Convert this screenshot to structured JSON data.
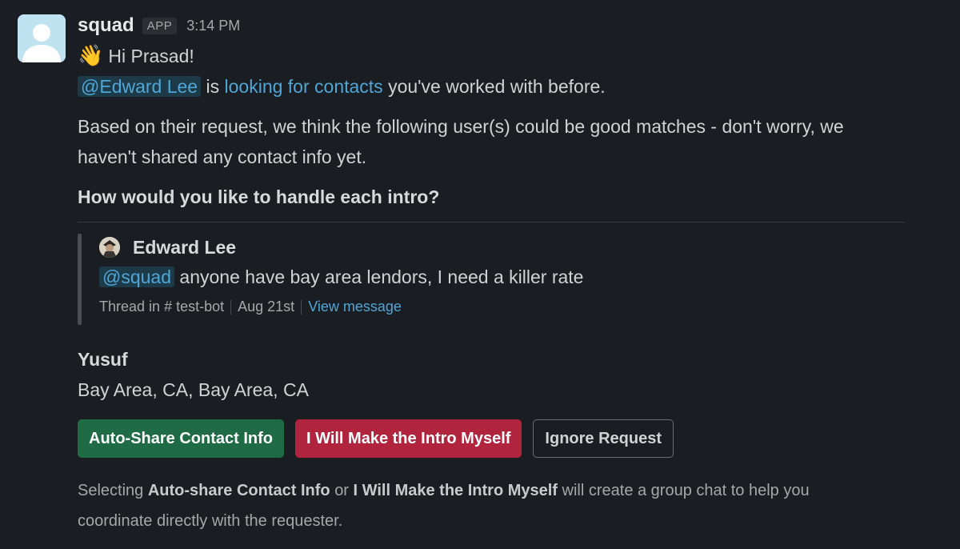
{
  "message": {
    "sender": "squad",
    "badge": "APP",
    "time": "3:14 PM",
    "greeting_emoji": "👋",
    "greeting_prefix": "Hi",
    "greeting_name": "Prasad!",
    "mention_user": "@Edward Lee",
    "is_text": "is",
    "request_link": "looking for contacts",
    "request_suffix": "you've worked with before.",
    "body": "Based on their request, we think the following user(s) could be good matches - don't worry, we haven't shared any contact info yet.",
    "question": "How would you like to handle each intro?"
  },
  "quote": {
    "author": "Edward Lee",
    "mention": "@squad",
    "text": "anyone have bay area lendors, I need a killer rate",
    "thread_prefix": "Thread in",
    "channel_icon": "#",
    "channel": "test-bot",
    "date": "Aug 21st",
    "view_link": "View message"
  },
  "match": {
    "name": "Yusuf",
    "location": "Bay Area, CA, Bay Area, CA"
  },
  "actions": {
    "auto_share": "Auto-Share Contact Info",
    "make_intro": "I Will Make the Intro Myself",
    "ignore": "Ignore Request"
  },
  "footnote": {
    "part1": "Selecting",
    "bold1": "Auto-share Contact Info",
    "part2": "or",
    "bold2": "I Will Make the Intro Myself",
    "part3": "will create a group chat to help you coordinate directly with the requester."
  },
  "colors": {
    "background": "#1a1d21",
    "link": "#4fa6d7",
    "green_button": "#1e6b46",
    "red_button": "#b0243e"
  },
  "icons": {
    "avatar": "user-avatar-icon",
    "quote_avatar": "edward-lee-avatar"
  }
}
